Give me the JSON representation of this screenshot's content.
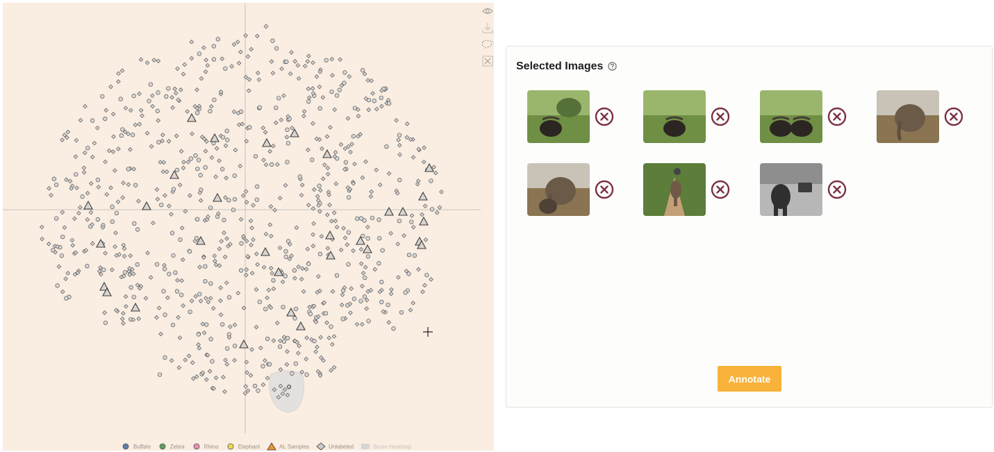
{
  "scatter_plot": {
    "tools": [
      {
        "name": "view",
        "icon": "eye-icon"
      },
      {
        "name": "download",
        "icon": "download-icon"
      },
      {
        "name": "lasso",
        "icon": "lasso-select-icon"
      },
      {
        "name": "clear",
        "icon": "clear-selection-icon"
      }
    ],
    "cursor_icon": "crosshair-cursor-icon",
    "legend": [
      {
        "label": "Buffalo",
        "shape": "circle",
        "color": "#5b7fa8"
      },
      {
        "label": "Zebra",
        "shape": "circle",
        "color": "#5fa05d"
      },
      {
        "label": "Rhino",
        "shape": "circle",
        "color": "#e58fb3"
      },
      {
        "label": "Elephant",
        "shape": "circle",
        "color": "#eed850"
      },
      {
        "label": "AL Samples",
        "shape": "triangle",
        "color": "#f0962f"
      },
      {
        "label": "Unlabeled",
        "shape": "diamond",
        "color": "#c9c9c9"
      },
      {
        "label": "Score Heatmap",
        "shape": "rect",
        "color": "#d5d5d5"
      }
    ],
    "colors": {
      "background": "#faede1",
      "point_fill": "#d6d6d6",
      "point_stroke": "#555555",
      "axis": "#c8c2bd"
    }
  },
  "selected_panel": {
    "title": "Selected Images",
    "help_icon": "question-circle-icon",
    "remove_icon": "close-circle-icon",
    "images": [
      {
        "subject": "buffalo",
        "icon": "buffalo-photo"
      },
      {
        "subject": "buffalo",
        "icon": "buffalo-photo"
      },
      {
        "subject": "buffalo",
        "icon": "buffalo-herd-photo"
      },
      {
        "subject": "elephant",
        "icon": "elephant-photo"
      },
      {
        "subject": "elephant",
        "icon": "elephant-calf-photo"
      },
      {
        "subject": "elephant",
        "icon": "elephant-road-photo"
      },
      {
        "subject": "elephant",
        "icon": "elephant-street-photo"
      }
    ],
    "annotate_label": "Annotate",
    "colors": {
      "accent": "#f9b23a",
      "remove": "#7a3043"
    }
  }
}
